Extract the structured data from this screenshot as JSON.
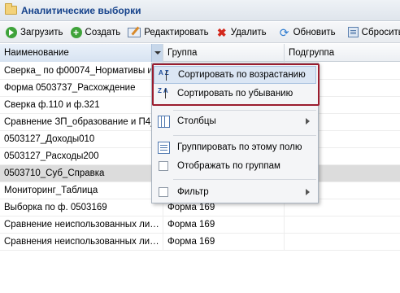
{
  "window": {
    "title": "Аналитические выборки",
    "icon": "folder-icon"
  },
  "toolbar": {
    "load": "Загрузить",
    "create": "Создать",
    "edit": "Редактировать",
    "delete": "Удалить",
    "refresh": "Обновить",
    "reset": "Сбросить"
  },
  "columns": {
    "name": "Наименование",
    "group": "Группа",
    "subgroup": "Подгруппа"
  },
  "rows": [
    {
      "name": "Сверка_ по ф00074_Нормативы и",
      "group": ""
    },
    {
      "name": "Форма 0503737_Расхождение",
      "group": ""
    },
    {
      "name": "Сверка ф.110 и ф.321",
      "group": ""
    },
    {
      "name": "Сравнение ЗП_образование и П4_",
      "group": ""
    },
    {
      "name": "0503127_Доходы010",
      "group": ""
    },
    {
      "name": "0503127_Расходы200",
      "group": ""
    },
    {
      "name": "0503710_Суб_Справка",
      "group": ""
    },
    {
      "name": "Мониторинг_Таблица",
      "group": ""
    },
    {
      "name": "Выборка по ф. 0503169",
      "group": "Форма 169"
    },
    {
      "name": "Сравнение неиспользованных лим…",
      "group": "Форма 169"
    },
    {
      "name": "Сравнения неиспользованных лим…",
      "group": "Форма 169"
    }
  ],
  "selected_row": 6,
  "menu": {
    "sort_asc": "Сортировать по возрастанию",
    "sort_desc": "Сортировать по убыванию",
    "columns": "Столбцы",
    "group_by": "Группировать по этому полю",
    "show_groups": "Отображать по группам",
    "filter": "Фильтр",
    "az_asc": "A Z",
    "az_desc": "Z A"
  },
  "colors": {
    "highlight_border": "#9b1c2e",
    "selected_row": "#dcdcdc",
    "title": "#15428b"
  }
}
